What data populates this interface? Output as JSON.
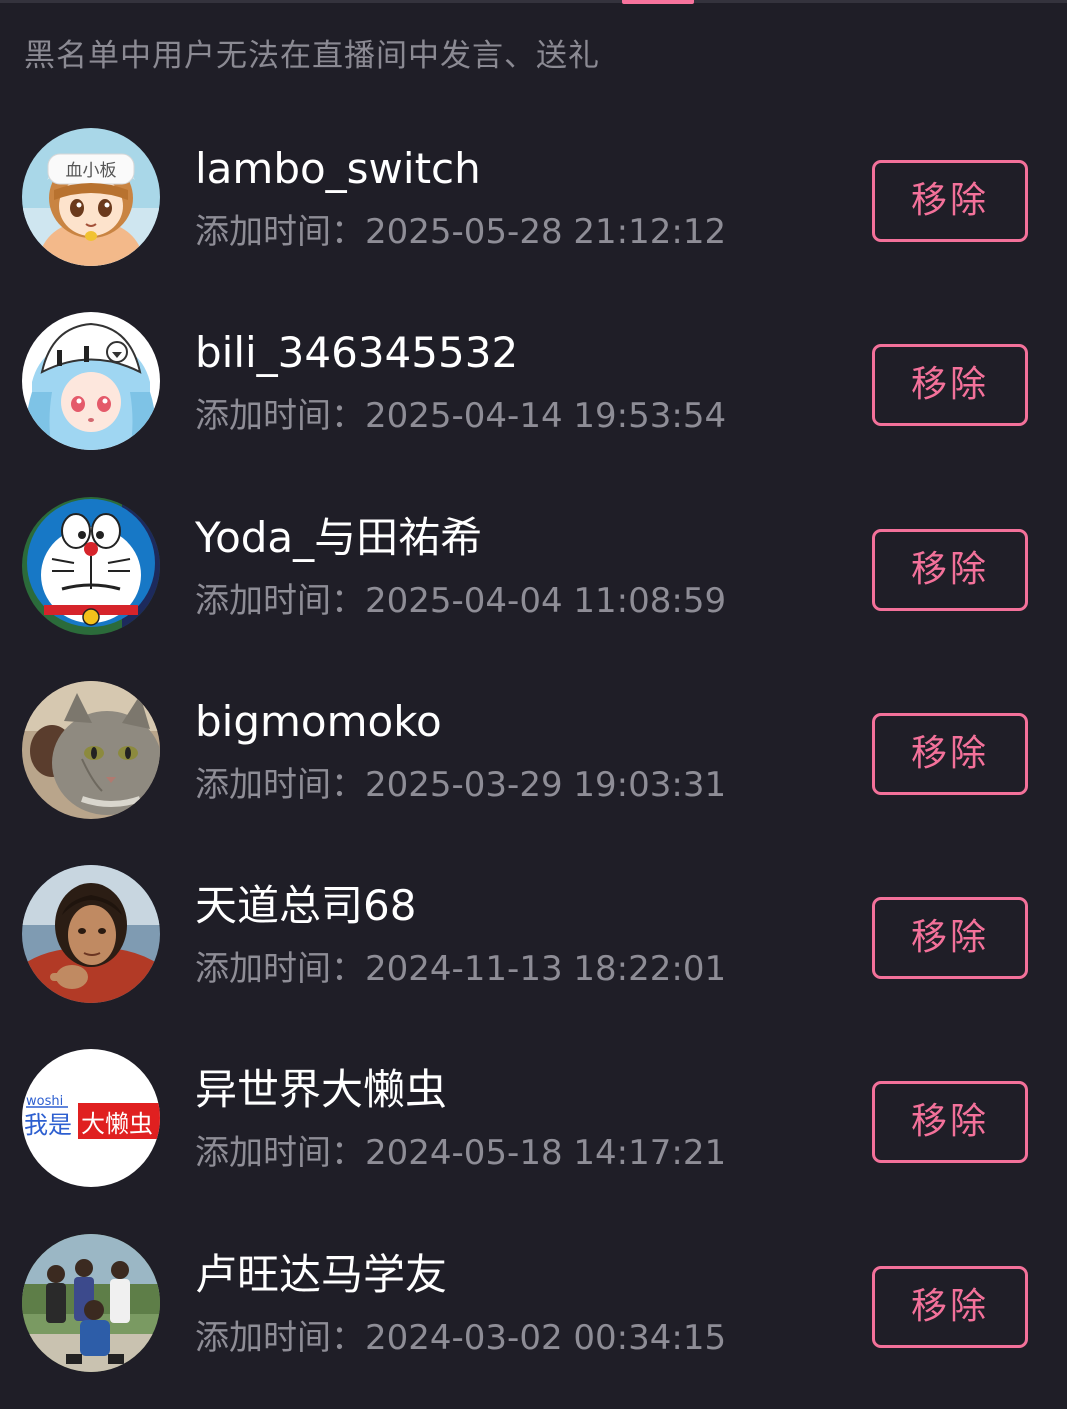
{
  "notice": "黑名单中用户无法在直播间中发言、送礼",
  "colors": {
    "background": "#1f1e27",
    "accent": "#f3719a",
    "secondary_text": "#8e8d96"
  },
  "blocklist": [
    {
      "username": "lambo_switch",
      "time_label": "添加时间：",
      "time": "2025-05-28 21:12:12",
      "remove_label": "移除",
      "avatar": "anime-girl-avatar",
      "avatar_text": "血小板"
    },
    {
      "username": "bili_346345532",
      "time_label": "添加时间：",
      "time": "2025-04-14 19:53:54",
      "remove_label": "移除",
      "avatar": "anime-girl-blue-hair-avatar"
    },
    {
      "username": "Yoda_与田祐希",
      "time_label": "添加时间：",
      "time": "2025-04-04 11:08:59",
      "remove_label": "移除",
      "avatar": "doraemon-avatar"
    },
    {
      "username": "bigmomoko",
      "time_label": "添加时间：",
      "time": "2025-03-29 19:03:31",
      "remove_label": "移除",
      "avatar": "cat-photo-avatar"
    },
    {
      "username": "天道总司68",
      "time_label": "添加时间：",
      "time": "2024-11-13 18:22:01",
      "remove_label": "移除",
      "avatar": "person-photo-avatar"
    },
    {
      "username": "异世界大懒虫",
      "time_label": "添加时间：",
      "time": "2024-05-18 14:17:21",
      "remove_label": "移除",
      "avatar": "text-logo-avatar",
      "avatar_text_top": "woshi",
      "avatar_text_left": "我是",
      "avatar_text_right": "大懒虫"
    },
    {
      "username": "卢旺达马学友",
      "time_label": "添加时间：",
      "time": "2024-03-02 00:34:15",
      "remove_label": "移除",
      "avatar": "group-photo-avatar"
    }
  ]
}
